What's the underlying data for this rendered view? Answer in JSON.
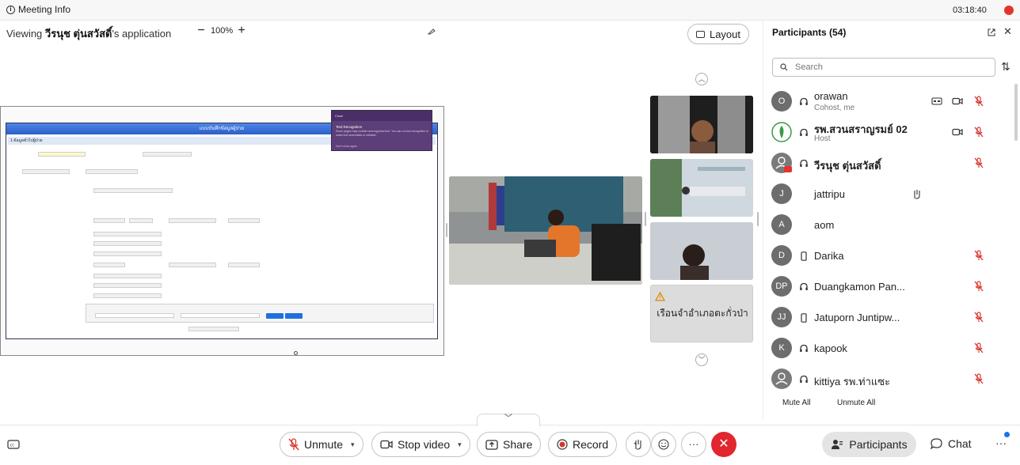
{
  "topbar": {
    "meeting_info": "Meeting Info",
    "clock": "03:18:40"
  },
  "viewing": {
    "prefix": "Viewing ",
    "presenter": "วีรนุช ตุ่นสวัสดิ์",
    "suffix": "'s application",
    "zoom": "100%",
    "zoom_minus": "−",
    "zoom_plus": "+"
  },
  "layout_button": "Layout",
  "shared_screen": {
    "form_title": "แบบบันทึกข้อมูลผู้ป่วย",
    "section": "1.ข้อมูลทั่วไปผู้ป่วย",
    "popup_head": "Close",
    "popup_title": "Text Recognition",
    "popup_body": "Some pages may contain unrecognized text. You can run text recognition to make text searchable or editable.",
    "popup_footer": "Don't show again"
  },
  "tiles": {
    "d_name": "เรือนจำอำเภอตะกั่วป่า"
  },
  "panel": {
    "title": "Participants (54)",
    "search_placeholder": "Search",
    "mute_all": "Mute All",
    "unmute_all": "Unmute All",
    "participants": [
      {
        "initials": "O",
        "name": "orawan",
        "sub": "Cohost, me",
        "device": "headset",
        "icons": [
          "cc",
          "camera",
          "mic-off"
        ]
      },
      {
        "initials": "",
        "name": "รพ.สวนสราญรมย์ 02",
        "sub": "Host",
        "device": "headset",
        "icons": [
          "camera",
          "mic-off"
        ]
      },
      {
        "initials": "",
        "name": "วีรนุช ตุ่นสวัสดิ์",
        "sub": "",
        "device": "headset",
        "icons": [
          "mic-off"
        ]
      },
      {
        "initials": "J",
        "name": "jattripu",
        "sub": "",
        "device": "",
        "icons": [
          "raise-hand"
        ]
      },
      {
        "initials": "A",
        "name": "aom",
        "sub": "",
        "device": "",
        "icons": []
      },
      {
        "initials": "D",
        "name": "Darika",
        "sub": "",
        "device": "phone",
        "icons": [
          "mic-off"
        ]
      },
      {
        "initials": "DP",
        "name": "Duangkamon Pan...",
        "sub": "",
        "device": "headset",
        "icons": [
          "mic-off"
        ]
      },
      {
        "initials": "JJ",
        "name": "Jatuporn Juntipw...",
        "sub": "",
        "device": "phone",
        "icons": [
          "mic-off"
        ]
      },
      {
        "initials": "K",
        "name": "kapook",
        "sub": "",
        "device": "headset",
        "icons": [
          "mic-off"
        ]
      },
      {
        "initials": "",
        "name": "kittiya รพ.ท่าแซะ",
        "sub": "",
        "device": "headset",
        "icons": [
          "mic-off"
        ]
      }
    ]
  },
  "controls": {
    "unmute": "Unmute",
    "stop_video": "Stop video",
    "share": "Share",
    "record": "Record",
    "participants": "Participants",
    "chat": "Chat",
    "more": "···"
  },
  "colors": {
    "end_red": "#e0262e",
    "mute_red": "#d9342b",
    "accent_blue": "#1a73e8"
  }
}
